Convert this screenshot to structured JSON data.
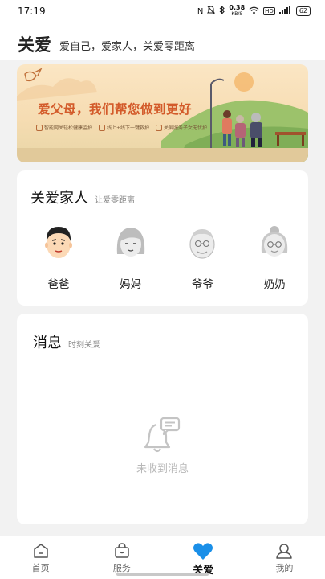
{
  "status_bar": {
    "time": "17:19",
    "speed_value": "0.38",
    "speed_unit": "KB/S",
    "battery": "62"
  },
  "header": {
    "title": "关爱",
    "subtitle": "爱自己，爱家人，关爱零距离"
  },
  "banner": {
    "title": "爱父母，我们帮您做到更好",
    "features": [
      "智能网关轻松健康监护",
      "线上+线下一键救护",
      "关爱服务子女无忧护"
    ]
  },
  "family": {
    "title": "关爱家人",
    "subtitle": "让爱零距离",
    "members": [
      {
        "name": "爸爸",
        "avatar": "father-avatar"
      },
      {
        "name": "妈妈",
        "avatar": "mother-avatar"
      },
      {
        "name": "爷爷",
        "avatar": "grandfather-avatar"
      },
      {
        "name": "奶奶",
        "avatar": "grandmother-avatar"
      }
    ]
  },
  "messages": {
    "title": "消息",
    "subtitle": "时刻关爱",
    "empty_text": "未收到消息",
    "empty_icon": "bell-message-icon"
  },
  "tabbar": {
    "tabs": [
      {
        "label": "首页",
        "icon": "home-icon",
        "active": false
      },
      {
        "label": "服务",
        "icon": "bag-icon",
        "active": false
      },
      {
        "label": "关爱",
        "icon": "heart-icon",
        "active": true
      },
      {
        "label": "我的",
        "icon": "person-icon",
        "active": false
      }
    ]
  },
  "colors": {
    "accent": "#1a8fe8",
    "banner_title": "#d35a2a",
    "background": "#f2f2f2"
  }
}
